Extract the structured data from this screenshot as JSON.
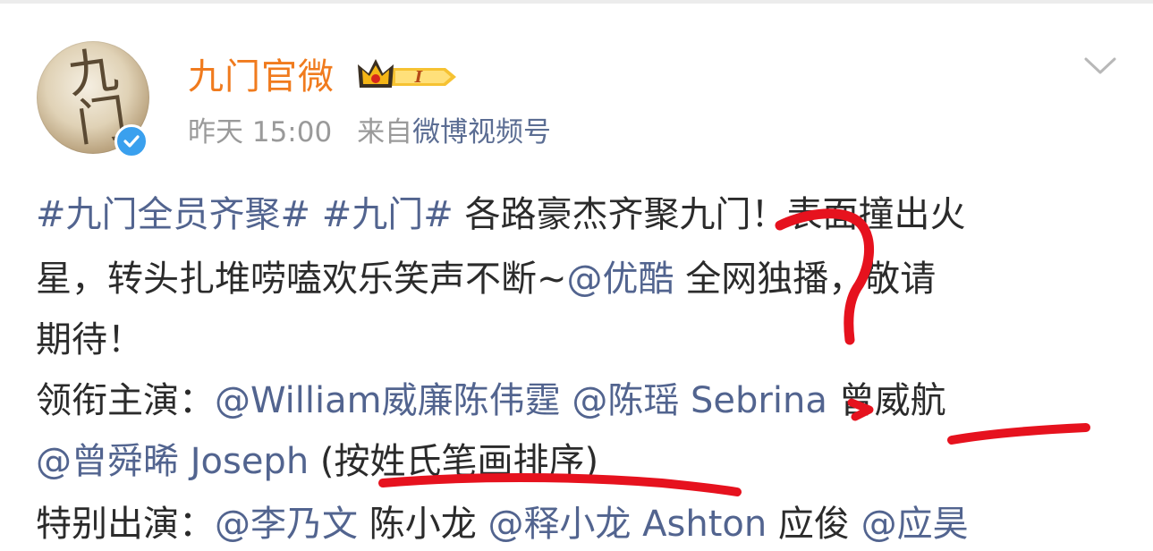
{
  "post": {
    "username": "九门官微",
    "vip_level": "I",
    "time": "昨天 15:00",
    "from_prefix": "来自",
    "source": "微博视频号",
    "avatar_text_1": "九",
    "avatar_text_2": "门",
    "text": {
      "l1_tag1": "#九门全员齐聚#",
      "l1_tag2": "#九门#",
      "l1_rest": " 各路豪杰齐聚九门！表面撞出火",
      "l2_a": "星，转头扎堆唠嗑欢乐笑声不断~",
      "l2_mention": "@优酷",
      "l2_b": " 全网独播，敬请",
      "l3": "期待！",
      "l4_label": "领衔主演：",
      "l4_m1": "@William威廉陈伟霆",
      "l4_m2": "@陈瑶 Sebrina",
      "l4_plain": " 曾威航",
      "l5_m1": "@曾舜晞 Joseph",
      "l5_note": " (按姓氏笔画排序)",
      "l6_label": "特别出演：",
      "l6_m1": "@李乃文",
      "l6_plain": " 陈小龙 ",
      "l6_m2": "@释小龙 Ashton",
      "l6_plain2": " 应俊 ",
      "l6_m3": "@应昊"
    }
  },
  "icons": {
    "more": "chevron-down-icon",
    "vip": "crown-vip-icon",
    "verified": "verified-check-icon"
  },
  "colors": {
    "username": "#f07b1e",
    "link": "#52648f",
    "text": "#2b2b2b",
    "meta": "#9a9a9a",
    "annotation": "#e6121e",
    "verified": "#3aa0ee"
  }
}
